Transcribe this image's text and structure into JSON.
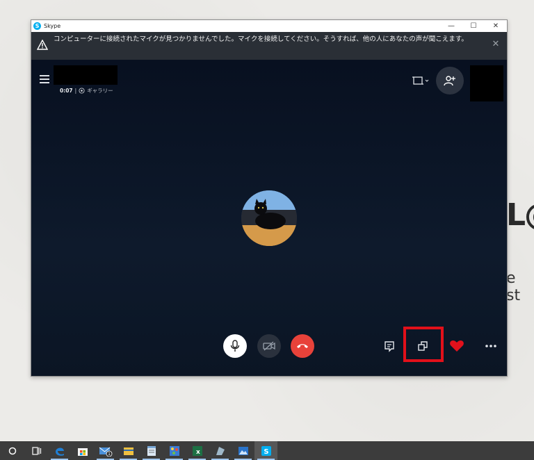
{
  "window": {
    "title": "Skype",
    "controls": {
      "minimize": "—",
      "maximize": "☐",
      "close": "✕"
    }
  },
  "notification": {
    "message": "コンピューターに接続されたマイクが見つかりませんでした。マイクを接続してください。そうすれば、他の人にあなたの声が聞こえます。",
    "close_icon": "close-icon"
  },
  "call": {
    "timer": "0:07",
    "separator": "|",
    "view_mode": "ギャラリー"
  },
  "controls": {
    "microphone": "microphone-icon",
    "video_off": "video-off-icon",
    "hang_up": "hang-up-icon",
    "chat": "chat-icon",
    "switch_window": "window-switch-icon",
    "reaction": "heart-icon",
    "more": "more-options-icon"
  },
  "highlight_color": "#e2101a",
  "background": {
    "logo_fragment": "L@",
    "text_fragment": "e st"
  },
  "taskbar": {
    "items": [
      "cortana",
      "task-view",
      "edge",
      "store",
      "mail",
      "explorer",
      "notepad",
      "paint",
      "excel",
      "app",
      "photos",
      "skype"
    ],
    "mail_badge": "1"
  }
}
